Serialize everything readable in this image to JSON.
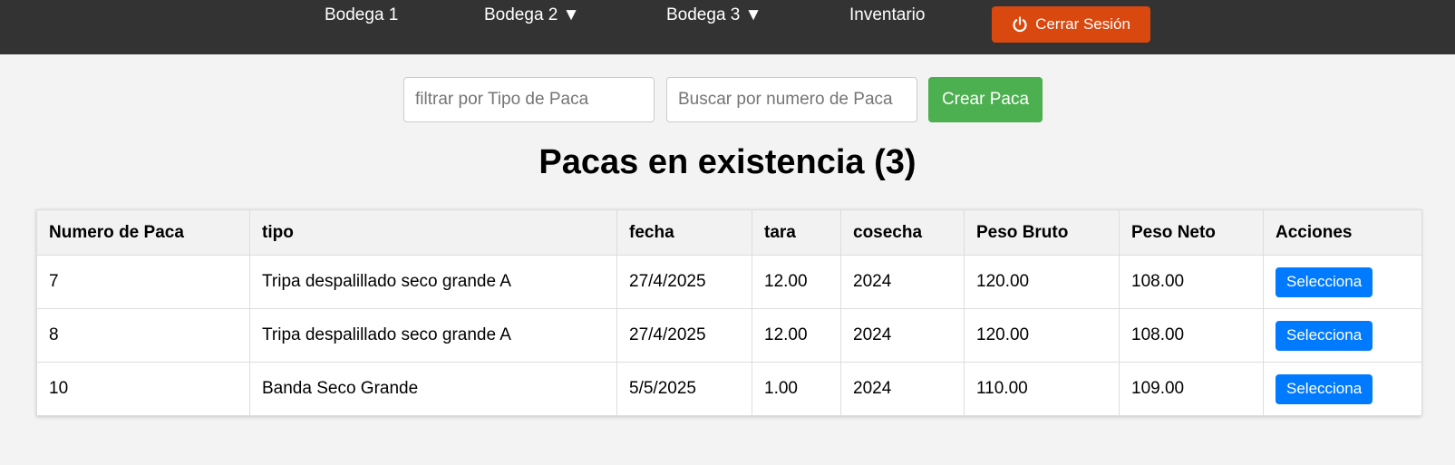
{
  "nav": {
    "items": [
      {
        "label": "Bodega 1"
      },
      {
        "label": "Bodega 2 ▼"
      },
      {
        "label": "Bodega 3 ▼"
      },
      {
        "label": "Inventario"
      }
    ],
    "logout_label": "Cerrar Sesión",
    "logout_icon": "power-icon"
  },
  "filters": {
    "type_placeholder": "filtrar por Tipo de Paca",
    "type_value": "",
    "number_placeholder": "Buscar por numero de Paca",
    "number_value": "",
    "create_label": "Crear Paca"
  },
  "title": "Pacas en existencia (3)",
  "table": {
    "headers": [
      "Numero de Paca",
      "tipo",
      "fecha",
      "tara",
      "cosecha",
      "Peso Bruto",
      "Peso Neto",
      "Acciones"
    ],
    "rows": [
      {
        "numero": "7",
        "tipo": "Tripa despalillado seco grande A",
        "fecha": "27/4/2025",
        "tara": "12.00",
        "cosecha": "2024",
        "peso_bruto": "120.00",
        "peso_neto": "108.00",
        "accion": "Selecciona"
      },
      {
        "numero": "8",
        "tipo": "Tripa despalillado seco grande A",
        "fecha": "27/4/2025",
        "tara": "12.00",
        "cosecha": "2024",
        "peso_bruto": "120.00",
        "peso_neto": "108.00",
        "accion": "Selecciona"
      },
      {
        "numero": "10",
        "tipo": "Banda Seco Grande",
        "fecha": "5/5/2025",
        "tara": "1.00",
        "cosecha": "2024",
        "peso_bruto": "110.00",
        "peso_neto": "109.00",
        "accion": "Selecciona"
      }
    ]
  },
  "colors": {
    "navbar": "#333333",
    "logout": "#d9480f",
    "create": "#4caf50",
    "select": "#007bff",
    "background": "#f3f3f3"
  }
}
